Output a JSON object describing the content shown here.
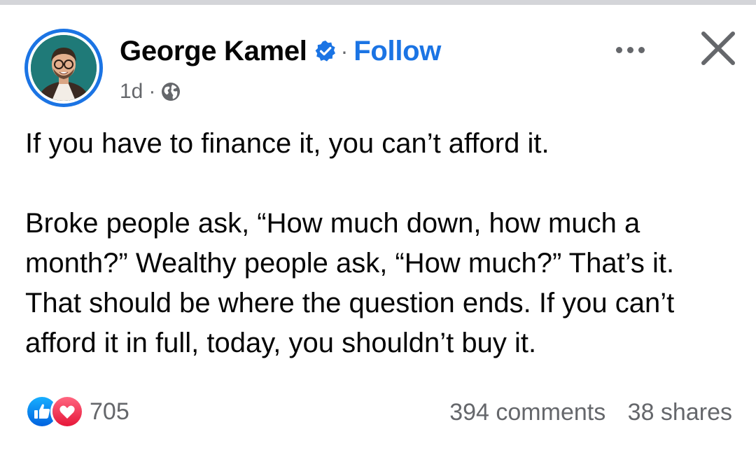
{
  "post": {
    "author": {
      "name": "George Kamel",
      "verified": true,
      "avatar_icon": "profile-photo"
    },
    "follow_label": "Follow",
    "separator": "·",
    "meta": {
      "time": "1d",
      "separator": "·",
      "audience_icon": "globe-icon"
    },
    "actions": {
      "more_icon": "more-options-icon",
      "close_icon": "close-icon"
    },
    "text": {
      "paragraph_1": "If you have to finance it, you can’t afford it.",
      "paragraph_2": "Broke people ask, “How much down, how much a month?” Wealthy people ask, “How much?” That’s it. That should be where the question ends. If you can’t afford it in full, today, you shouldn’t buy it."
    },
    "footer": {
      "reaction_icons": [
        "like-icon",
        "love-icon"
      ],
      "reaction_count": "705",
      "comments": "394 comments",
      "shares": "38 shares"
    }
  },
  "colors": {
    "accent": "#1b74e4",
    "secondary_text": "#65676b",
    "primary_text": "#050505",
    "love": "#f02849"
  }
}
